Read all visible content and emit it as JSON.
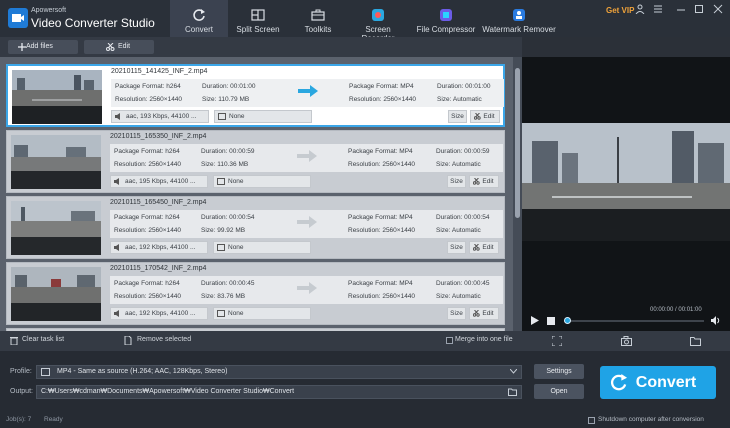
{
  "app": {
    "brand_small": "Apowersoft",
    "brand_big": "Video Converter Studio",
    "get_vip": "Get VIP"
  },
  "nav": {
    "tabs": [
      {
        "label": "Convert",
        "icon": "refresh-icon",
        "active": true
      },
      {
        "label": "Split Screen",
        "icon": "split-screen-icon"
      },
      {
        "label": "Toolkits",
        "icon": "toolbox-icon"
      },
      {
        "label": "Screen Recorder",
        "icon": "screen-recorder-icon"
      },
      {
        "label": "File Compressor",
        "icon": "file-compressor-icon"
      },
      {
        "label": "Watermark Remover",
        "icon": "watermark-remover-icon"
      }
    ]
  },
  "toolbar": {
    "add_files": "Add files",
    "edit": "Edit"
  },
  "files": [
    {
      "name": "20210115_141425_INF_2.mp4",
      "src_format": "Package Format: h264",
      "src_duration": "Duration: 00:01:00",
      "src_resolution": "Resolution: 2560×1440",
      "src_size": "Size: 110.79 MB",
      "out_format": "Package Format: MP4",
      "out_duration": "Duration: 00:01:00",
      "out_resolution": "Resolution: 2560×1440",
      "out_size": "Size: Automatic",
      "audio": "aac, 193 Kbps, 44100 ...",
      "subtitle": "None",
      "size_btn": "Size",
      "edit_btn": "Edit",
      "selected": true
    },
    {
      "name": "20210115_165350_INF_2.mp4",
      "src_format": "Package Format: h264",
      "src_duration": "Duration: 00:00:59",
      "src_resolution": "Resolution: 2560×1440",
      "src_size": "Size: 110.36 MB",
      "out_format": "Package Format: MP4",
      "out_duration": "Duration: 00:00:59",
      "out_resolution": "Resolution: 2560×1440",
      "out_size": "Size: Automatic",
      "audio": "aac, 195 Kbps, 44100 ...",
      "subtitle": "None",
      "size_btn": "Size",
      "edit_btn": "Edit",
      "selected": false
    },
    {
      "name": "20210115_165450_INF_2.mp4",
      "src_format": "Package Format: h264",
      "src_duration": "Duration: 00:00:54",
      "src_resolution": "Resolution: 2560×1440",
      "src_size": "Size: 99.92 MB",
      "out_format": "Package Format: MP4",
      "out_duration": "Duration: 00:00:54",
      "out_resolution": "Resolution: 2560×1440",
      "out_size": "Size: Automatic",
      "audio": "aac, 192 Kbps, 44100 ...",
      "subtitle": "None",
      "size_btn": "Size",
      "edit_btn": "Edit",
      "selected": false
    },
    {
      "name": "20210115_170542_INF_2.mp4",
      "src_format": "Package Format: h264",
      "src_duration": "Duration: 00:00:45",
      "src_resolution": "Resolution: 2560×1440",
      "src_size": "Size: 83.76 MB",
      "out_format": "Package Format: MP4",
      "out_duration": "Duration: 00:00:45",
      "out_resolution": "Resolution: 2560×1440",
      "out_size": "Size: Automatic",
      "audio": "aac, 192 Kbps, 44100 ...",
      "subtitle": "None",
      "size_btn": "Size",
      "edit_btn": "Edit",
      "selected": false
    }
  ],
  "list_actions": {
    "clear": "Clear task list",
    "remove": "Remove selected",
    "merge": "Merge into one file"
  },
  "player": {
    "time": "00:00:00 / 00:01:00"
  },
  "output": {
    "profile_label": "Profile:",
    "profile_value": "MP4 - Same as source (H.264; AAC, 128Kbps, Stereo)",
    "output_label": "Output:",
    "output_value": "C:₩Users₩cdman₩Documents₩Apowersoft₩Video Converter Studio₩Convert",
    "settings": "Settings",
    "open": "Open",
    "convert": "Convert",
    "shutdown": "Shutdown computer after conversion"
  },
  "status": {
    "jobs": "Job(s): 7",
    "state": "Ready"
  },
  "colors": {
    "accent": "#1fa3e6",
    "vip": "#f0a33a",
    "selected_border": "#3ba6e8"
  }
}
